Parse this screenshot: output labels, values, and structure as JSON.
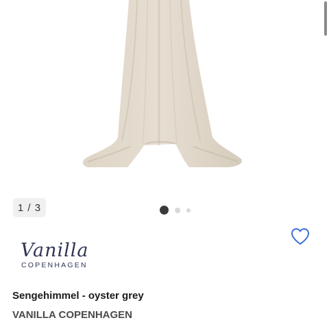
{
  "gallery": {
    "counter": "1 / 3",
    "current_page": 1,
    "total_pages": 3
  },
  "brand_logo": {
    "script_text": "Vanilla",
    "sub_text": "COPENHAGEN"
  },
  "product": {
    "name": "Sengehimmel - oyster grey",
    "brand": "VANILLA COPENHAGEN"
  },
  "icons": {
    "wishlist": "heart-outline-icon"
  },
  "colors": {
    "accent": "#3b6fd4",
    "canopy": "#d9cfc0",
    "dot_active": "#3a3a3a",
    "dot_inactive": "#d8d8d8",
    "logo": "#2f3552"
  }
}
